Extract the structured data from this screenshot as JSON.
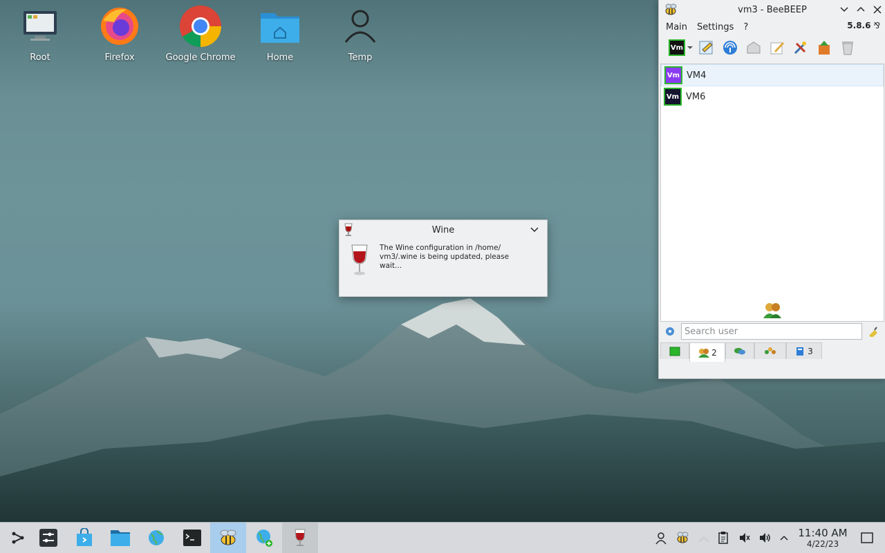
{
  "desktop": {
    "icons": [
      {
        "label": "Root"
      },
      {
        "label": "Firefox"
      },
      {
        "label": "Google Chrome"
      },
      {
        "label": "Home"
      },
      {
        "label": "Temp"
      }
    ]
  },
  "wine_dialog": {
    "title": "Wine",
    "message_line1": "The Wine configuration in /home/",
    "message_line2": "vm3/.wine is being updated, please wait..."
  },
  "beebeep": {
    "title": "vm3 - BeeBEEP",
    "menu": {
      "main": "Main",
      "settings": "Settings",
      "help": "?"
    },
    "version": "5.8.6",
    "status_badge": "Vm",
    "users": [
      {
        "badge": "Vm",
        "name": "VM4",
        "badge_color": "#8a3cf0"
      },
      {
        "badge": "Vm",
        "name": "VM6",
        "badge_color": "#14142e"
      }
    ],
    "search": {
      "placeholder": "Search user",
      "value": ""
    },
    "tabs": [
      {
        "icon": "home-tab-icon",
        "count": ""
      },
      {
        "icon": "users-tab-icon",
        "count": "2"
      },
      {
        "icon": "chat-tab-icon",
        "count": ""
      },
      {
        "icon": "groups-tab-icon",
        "count": ""
      },
      {
        "icon": "files-tab-icon",
        "count": "3"
      }
    ]
  },
  "taskbar": {
    "clock": {
      "time": "11:40 AM",
      "date": "4/22/23"
    }
  },
  "colors": {
    "taskbar_bg": "#d7d9dc",
    "active_task": "#a9cdec",
    "online_border": "#2bb52b"
  }
}
